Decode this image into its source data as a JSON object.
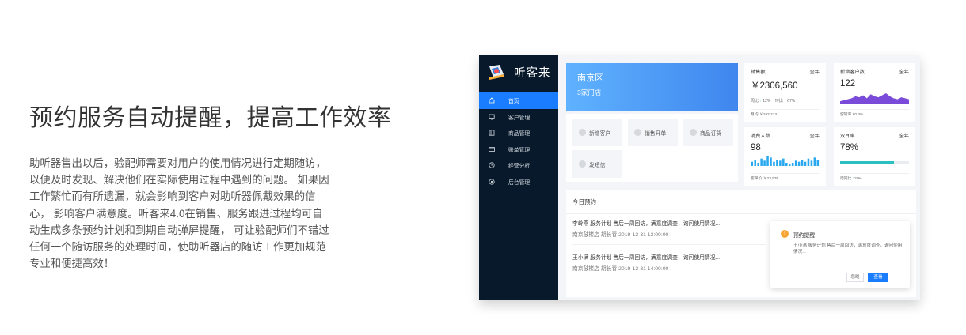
{
  "hero": {
    "title": "预约服务自动提醒，提高工作效率",
    "description": "助听器售出以后，验配师需要对用户的使用情况进行定期随访，以便及时发现、解决他们在实际使用过程中遇到的问题。 如果因工作繁忙而有所遗漏，就会影响到客户对助听器佩戴效果的信心， 影响客户满意度。听客来4.0在销售、服务跟进过程均可自动生成多条预约计划和到期自动弹屏提醒， 可让验配师们不错过任何一个随访服务的处理时间，使助听器店的随访工作更加规范专业和便捷高效！"
  },
  "app": {
    "brand": "听客来",
    "nav": [
      {
        "label": "首页",
        "icon": "home-icon",
        "active": true
      },
      {
        "label": "客户管理",
        "icon": "monitor-icon",
        "active": false
      },
      {
        "label": "商品管理",
        "icon": "book-icon",
        "active": false
      },
      {
        "label": "账单管理",
        "icon": "card-icon",
        "active": false
      },
      {
        "label": "经营分析",
        "icon": "clock-icon",
        "active": false
      },
      {
        "label": "后台管理",
        "icon": "settings-icon",
        "active": false
      }
    ],
    "region": {
      "name": "南京区",
      "stores": "3家门店"
    },
    "quick_actions": [
      "新增客户",
      "销售开单",
      "商品订货",
      "发短信"
    ],
    "stats": {
      "sales": {
        "title": "销售额",
        "period": "全年",
        "value": "￥2306,560",
        "wow_label": "周比",
        "wow": "12%",
        "yoy_label": "环比",
        "yoy": "67%",
        "foot": "月均 ￥192,213"
      },
      "new_customers": {
        "title": "新增客户数",
        "period": "全年",
        "value": "122",
        "foot": "留转率 80.3%"
      },
      "consumers": {
        "title": "消费人数",
        "period": "全年",
        "value": "98",
        "foot": "客单价 ￥23,536"
      },
      "return_rate": {
        "title": "双耳率",
        "period": "全年",
        "value": "78%",
        "progress_percent": 78,
        "foot_label": "周同比",
        "foot_value": "20%"
      }
    },
    "consumer_bars": [
      4,
      6,
      3,
      7,
      5,
      9,
      8,
      4,
      6,
      5,
      7,
      3,
      2,
      3,
      5,
      4,
      6,
      4,
      7,
      5,
      8,
      6
    ],
    "new_customer_trend": [
      3,
      4,
      5,
      6,
      8,
      7,
      9,
      6,
      10,
      8,
      7,
      9,
      11,
      8,
      6,
      5,
      7,
      6,
      5
    ],
    "today": {
      "title": "今日预约",
      "items": [
        {
          "line1": "李岭燕  服务计划 售后一周回访，满意度调查，询问使用情况...",
          "line2": "南京鼓楼店   胡长春   2019-12-31 13:00:00"
        },
        {
          "line1": "王小满  服务计划 售后一周回访，满意度调查，询问使用情况...",
          "line2": "南京鼓楼店   胡长春   2019-12-31 14:00:00"
        }
      ]
    },
    "popup": {
      "title": "预约提醒",
      "body": "王小满  服务计划 售后一周回访，满意度调查，询问使用情况...",
      "ignore": "忽略",
      "view": "查看"
    },
    "colors": {
      "accent": "#1a7dff",
      "sidebar": "#07192b",
      "trend": "#7a4bd8",
      "bars": "#29a8ef",
      "progress": "#2bbfbf"
    }
  }
}
